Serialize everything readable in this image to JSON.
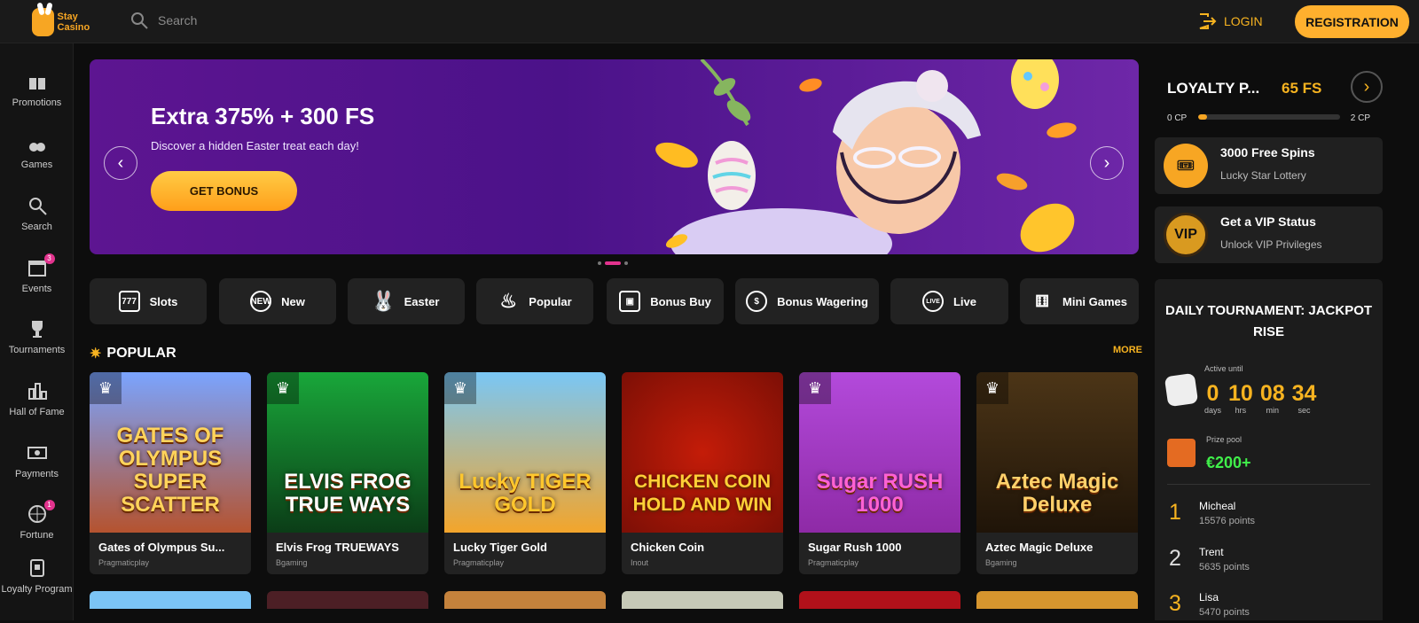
{
  "header": {
    "logo_text": "Stay Casino",
    "search_placeholder": "Search",
    "login_label": "LOGIN",
    "register_label": "REGISTRATION"
  },
  "sidebar": {
    "items": [
      {
        "label": "Promotions",
        "icon": "gift-icon"
      },
      {
        "label": "Games",
        "icon": "cherries-icon"
      },
      {
        "label": "Search",
        "icon": "search-icon"
      },
      {
        "label": "Events",
        "icon": "calendar-icon",
        "badge": "3"
      },
      {
        "label": "Tournaments",
        "icon": "trophy-icon"
      },
      {
        "label": "Hall of Fame",
        "icon": "bar-chart-icon"
      },
      {
        "label": "Payments",
        "icon": "cash-icon"
      },
      {
        "label": "Fortune",
        "icon": "wheel-icon",
        "badge": "1"
      },
      {
        "label": "Loyalty Program",
        "icon": "loyalty-icon"
      }
    ]
  },
  "banner": {
    "title": "Extra 375% + 300 FS",
    "subtitle": "Discover a hidden Easter treat each day!",
    "button": "GET BONUS",
    "prev": "‹",
    "next": "›"
  },
  "categories": [
    {
      "label": "Slots",
      "icon": "slots-icon"
    },
    {
      "label": "New",
      "icon": "new-icon"
    },
    {
      "label": "Easter",
      "icon": "rabbit-icon"
    },
    {
      "label": "Popular",
      "icon": "flame-icon"
    },
    {
      "label": "Bonus Buy",
      "icon": "gift-icon"
    },
    {
      "label": "Bonus Wagering",
      "icon": "dollar-cycle-icon"
    },
    {
      "label": "Live",
      "icon": "live-icon"
    },
    {
      "label": "Mini Games",
      "icon": "dice-icon"
    }
  ],
  "popular": {
    "title": "POPULAR",
    "more": "MORE",
    "games": [
      {
        "name": "Gates of Olympus Su...",
        "provider": "Pragmaticplay",
        "art": "GATES OF OLYMPUS SUPER SCATTER",
        "colors": [
          "#7aa4ff",
          "#b5532f"
        ]
      },
      {
        "name": "Elvis Frog TRUEWAYS",
        "provider": "Bgaming",
        "art": "ELVIS FROG TRUE WAYS",
        "colors": [
          "#19a73a",
          "#0b3d17"
        ]
      },
      {
        "name": "Lucky Tiger Gold",
        "provider": "Pragmaticplay",
        "art": "Lucky TIGER GOLD",
        "colors": [
          "#79c7f6",
          "#f3a52b"
        ]
      },
      {
        "name": "Chicken Coin",
        "provider": "Inout",
        "art": "CHICKEN COIN HOLD AND WIN",
        "colors": [
          "#c41c08",
          "#7c0f06"
        ]
      },
      {
        "name": "Sugar Rush 1000",
        "provider": "Pragmaticplay",
        "art": "Sugar RUSH 1000",
        "colors": [
          "#b34adb",
          "#8e2aa6"
        ]
      },
      {
        "name": "Aztec Magic Deluxe",
        "provider": "Bgaming",
        "art": "Aztec Magic Deluxe",
        "colors": [
          "#4c3517",
          "#1f1408"
        ]
      }
    ]
  },
  "loyalty": {
    "title": "LOYALTY P...",
    "free_spins": "65 FS",
    "from": "0 CP",
    "to": "2 CP",
    "progress": 0.06,
    "arrow": "›"
  },
  "promos": [
    {
      "title": "3000 Free Spins",
      "subtitle": "Lucky Star Lottery",
      "icon": "ticket-icon",
      "icon_text": "🎟"
    },
    {
      "title": "Get a VIP Status",
      "subtitle": "Unlock VIP Privileges",
      "icon": "vip-icon",
      "icon_text": "VIP"
    }
  ],
  "tournament": {
    "title": "DAILY TOURNAMENT: JACKPOT RISE",
    "active_until": "Active until",
    "timer": [
      {
        "value": "0",
        "label": "days"
      },
      {
        "value": "10",
        "label": "hrs"
      },
      {
        "value": "08",
        "label": "min"
      },
      {
        "value": "34",
        "label": "sec"
      }
    ],
    "prize_pool_label": "Prize pool",
    "prize_pool": "€200+",
    "leaders": [
      {
        "rank": "1",
        "name": "Micheal",
        "points": "15576 points"
      },
      {
        "rank": "2",
        "name": "Trent",
        "points": "5635 points"
      },
      {
        "rank": "3",
        "name": "Lisa",
        "points": "5470 points"
      }
    ]
  },
  "colors": {
    "accent": "#ffb02e",
    "badge": "#e3338e",
    "prize": "#40ef4a"
  }
}
